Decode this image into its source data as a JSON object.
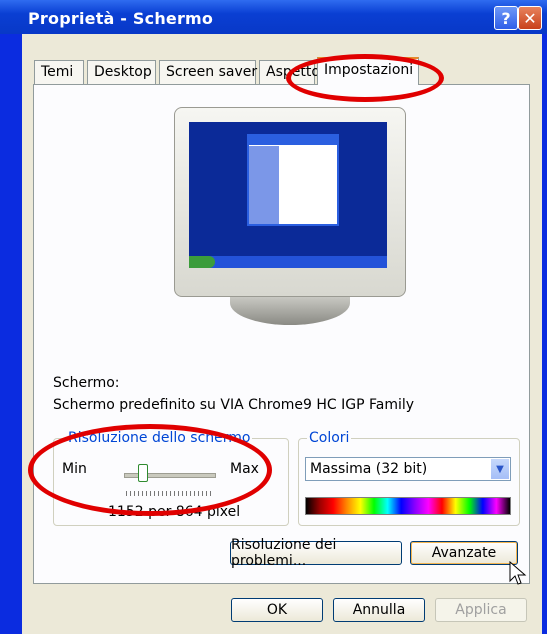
{
  "window": {
    "title": "Proprietà - Schermo",
    "help_glyph": "?",
    "close_glyph": "✕"
  },
  "tabs": [
    {
      "label": "Temi"
    },
    {
      "label": "Desktop"
    },
    {
      "label": "Screen saver"
    },
    {
      "label": "Aspetto"
    },
    {
      "label": "Impostazioni",
      "active": true
    }
  ],
  "display": {
    "heading": "Schermo:",
    "device": "Schermo predefinito su VIA Chrome9 HC IGP Family"
  },
  "resolution": {
    "legend": "Risoluzione dello schermo",
    "min_label": "Min",
    "max_label": "Max",
    "value_text": "1152 per 864 pixel"
  },
  "colors": {
    "legend": "Colori",
    "selected": "Massima (32 bit)"
  },
  "buttons": {
    "troubleshoot": "Risoluzione dei problemi...",
    "advanced": "Avanzate",
    "ok": "OK",
    "cancel": "Annulla",
    "apply": "Applica"
  },
  "annotations_color": "#e00000",
  "accent": "#0b2ce0"
}
